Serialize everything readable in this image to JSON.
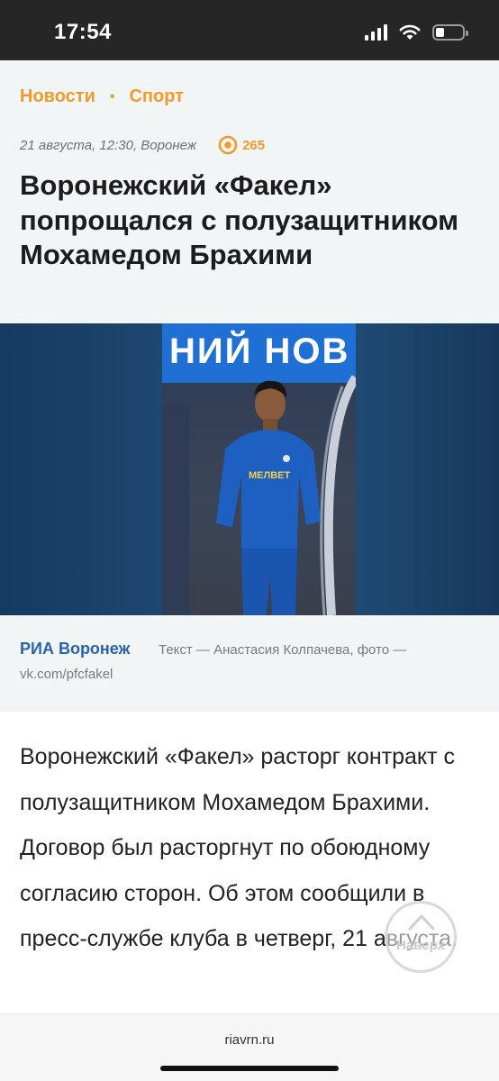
{
  "status_bar": {
    "time": "17:54"
  },
  "breadcrumbs": {
    "section": "Новости",
    "separator": "•",
    "subsection": "Спорт"
  },
  "article": {
    "meta": "21 августа, 12:30, Воронеж",
    "views": "265",
    "title": "Воронежский «Факел» попрощался с полузащитником Мохамедом Брахими",
    "photo": {
      "banner_text": "НИЙ НОВ",
      "jersey_sponsor": "МЕЛBЕТ"
    },
    "credit": {
      "source": "РИА Воронеж",
      "byline": "Текст — Анастасия Колпачева, фото —",
      "photo_source": "vk.com/pfcfakel"
    },
    "lead": "Воронежский «Факел» расторг контракт с полузащитником Мохамедом Брахими. Договор был расторгнут по обоюдному согласию сторон. Об этом сообщили в пресс-службе клуба в четверг, 21 августа."
  },
  "scroll_top_label": "Наверх",
  "browser": {
    "domain": "riavrn.ru"
  },
  "colors": {
    "accent": "#f19a2b",
    "source_blue": "#2b62b0",
    "status_bar": "#262626"
  }
}
